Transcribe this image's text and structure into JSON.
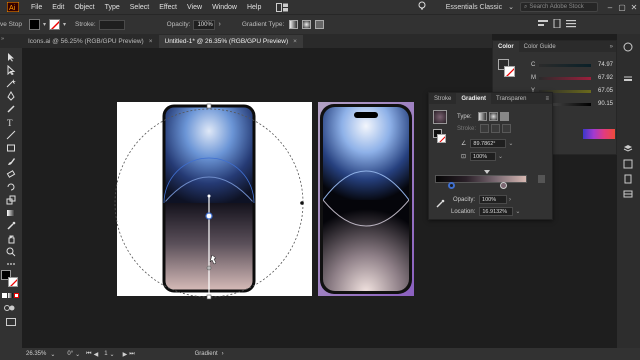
{
  "menubar": {
    "items": [
      "File",
      "Edit",
      "Object",
      "Type",
      "Select",
      "Effect",
      "View",
      "Window",
      "Help"
    ],
    "workspace": "Essentials Classic",
    "search_placeholder": "Search Adobe Stock"
  },
  "controlbar": {
    "left_label": "ve Stop",
    "stroke_label": "Stroke:",
    "opacity_label": "Opacity:",
    "opacity_value": "100%",
    "gradient_type_label": "Gradient Type:"
  },
  "tabs": [
    {
      "label": "Icons.ai @ 56.25% (RGB/GPU Preview)",
      "active": false
    },
    {
      "label": "Untitled-1* @ 26.35% (RGB/GPU Preview)",
      "active": true
    }
  ],
  "color_panel": {
    "tabs": [
      "Color",
      "Color Guide"
    ],
    "sliders": [
      {
        "label": "C",
        "value": "74.97"
      },
      {
        "label": "M",
        "value": "67.92"
      },
      {
        "label": "Y",
        "value": "67.05"
      },
      {
        "label": "K",
        "value": "90.15"
      }
    ]
  },
  "gradient_panel": {
    "tabs": [
      "Stroke",
      "Gradient",
      "Transparen"
    ],
    "type_label": "Type:",
    "stroke_label": "Stroke:",
    "angle_value": "89.7862°",
    "aspect_value": "100%",
    "opacity_label": "Opacity:",
    "opacity_value": "100%",
    "location_label": "Location:",
    "location_value": "16.9132%"
  },
  "statusbar": {
    "zoom": "26.35%",
    "rotation": "0°",
    "artboard_num": "1",
    "tool_name": "Gradient"
  },
  "colors": {
    "accent_blue": "#3f6fd0",
    "phone_blue": "#3f6fb8",
    "phone_pink": "#d6b7b4"
  }
}
